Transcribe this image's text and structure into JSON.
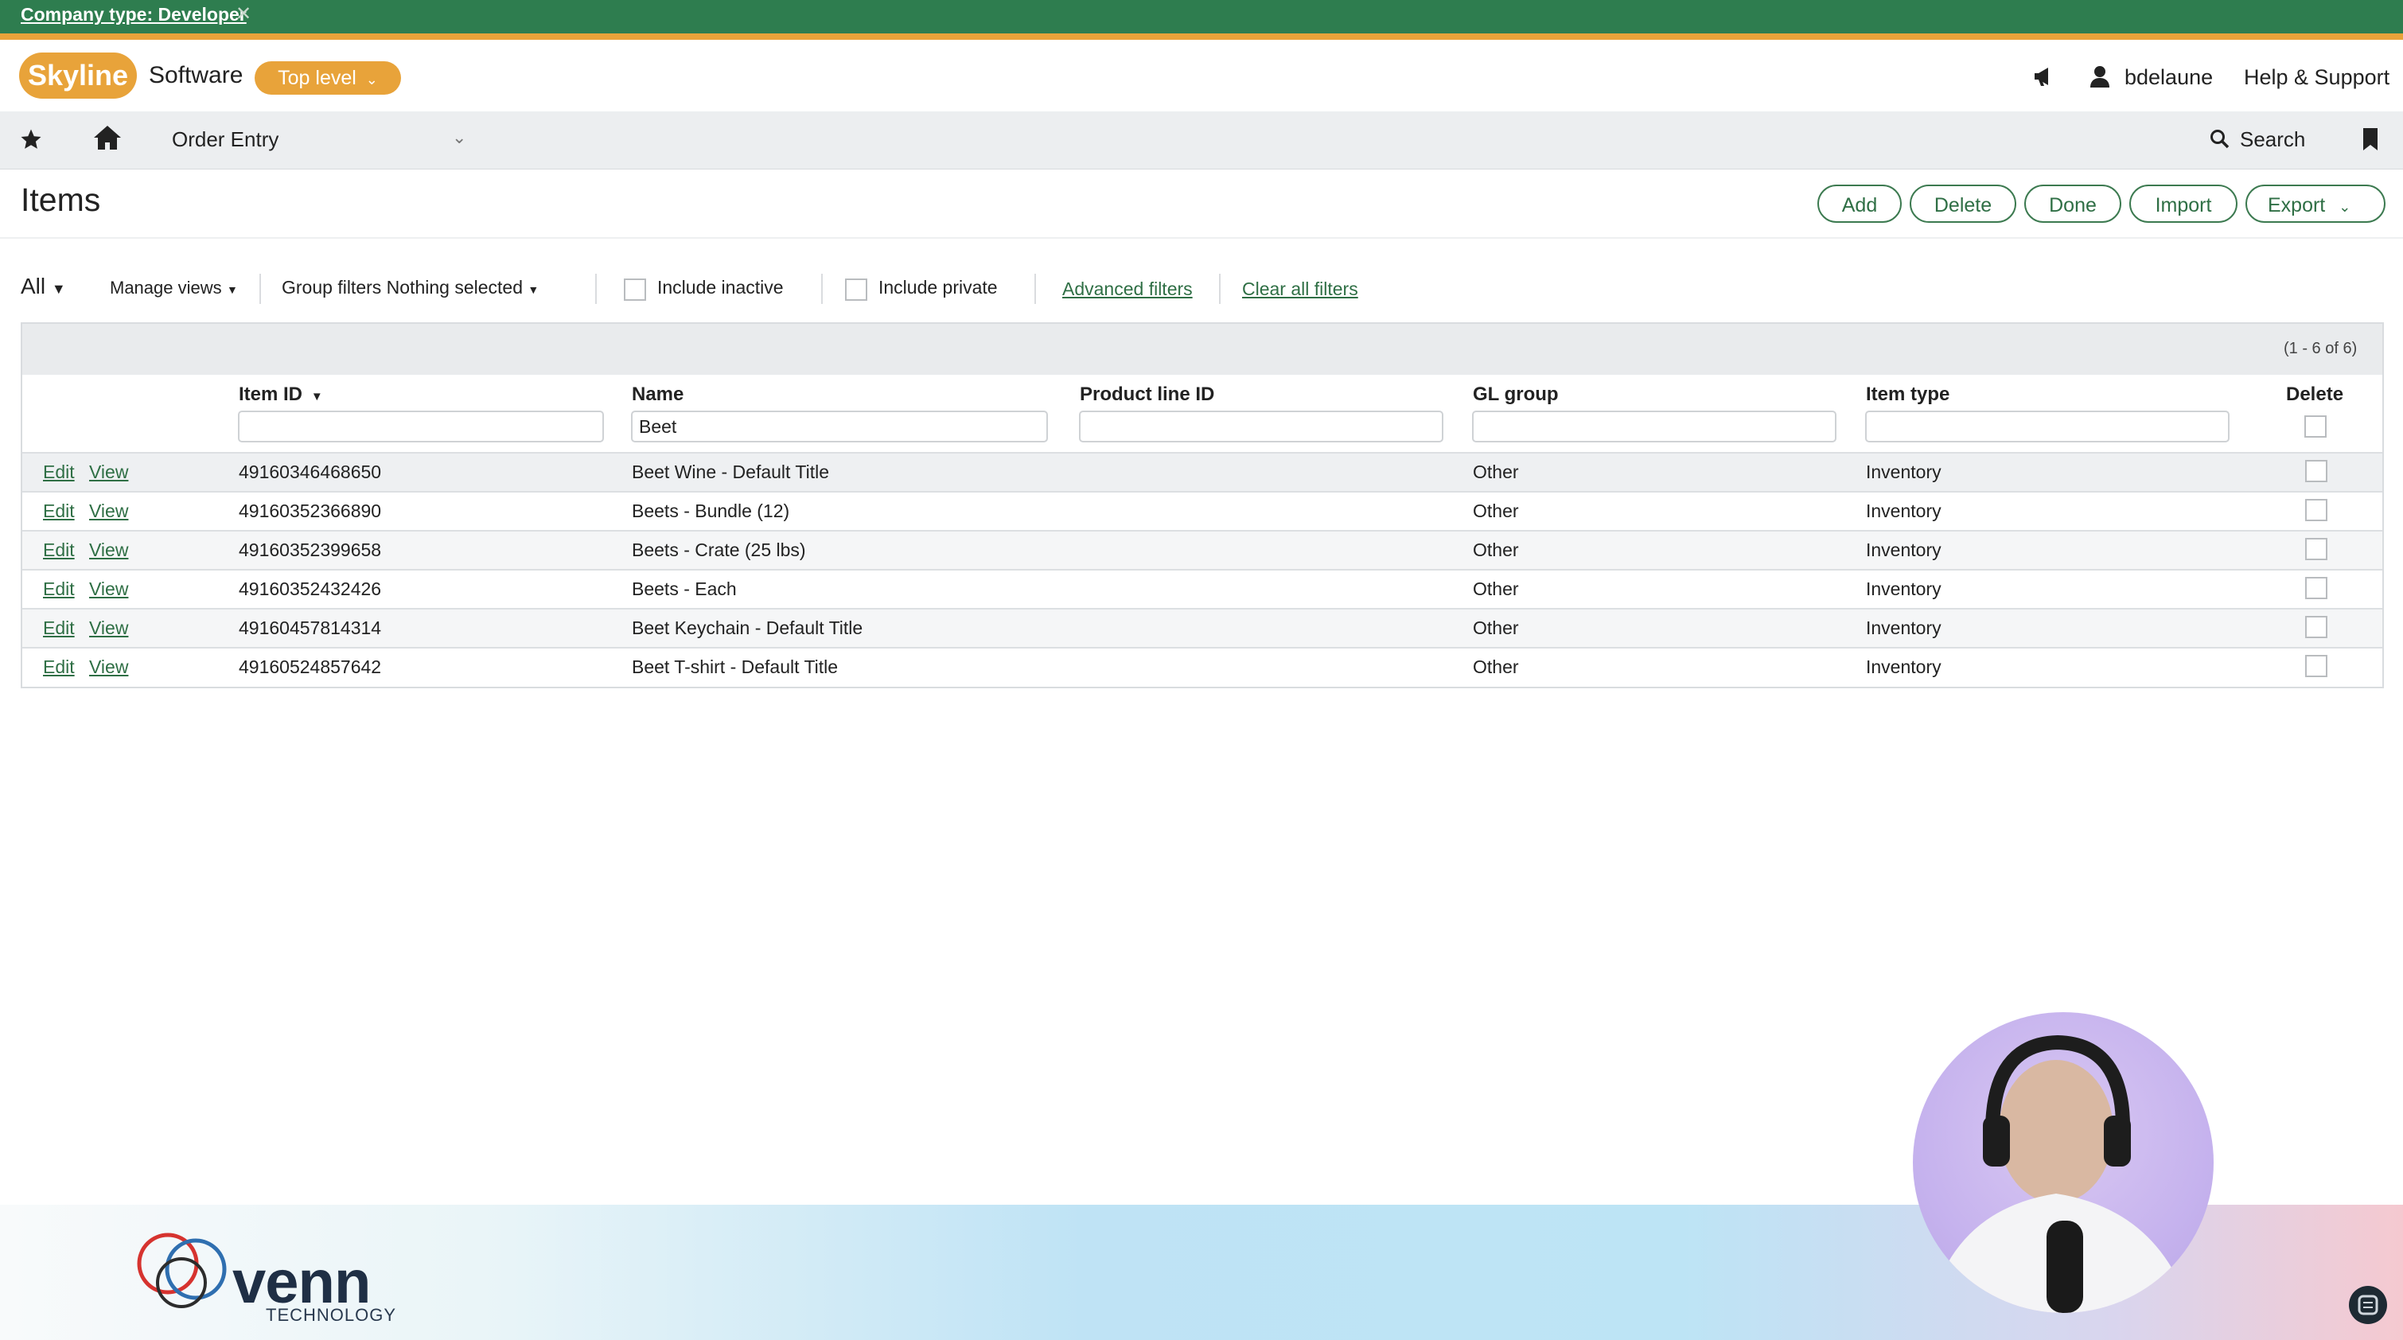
{
  "banner": {
    "text": "Company type: Developer",
    "close": "✕"
  },
  "header": {
    "logo": "Skyline",
    "logo_sub": "Software",
    "level": "Top level",
    "user": "bdelaune",
    "help": "Help & Support"
  },
  "nav": {
    "title": "Order Entry",
    "search": "Search"
  },
  "page": {
    "title": "Items",
    "buttons": {
      "add": "Add",
      "delete": "Delete",
      "done": "Done",
      "import": "Import",
      "export": "Export"
    }
  },
  "filters": {
    "view": "All",
    "manage_views": "Manage views",
    "group_filters_label": "Group filters",
    "group_filters_value": "Nothing selected",
    "include_inactive": "Include inactive",
    "include_private": "Include private",
    "advanced": "Advanced filters",
    "clear": "Clear all filters"
  },
  "grid": {
    "count": "(1 - 6 of 6)",
    "columns": {
      "item_id": "Item ID",
      "name": "Name",
      "product_line": "Product line ID",
      "gl_group": "GL group",
      "item_type": "Item type",
      "delete": "Delete"
    },
    "name_filter": "Beet",
    "edit_label": "Edit",
    "view_label": "View",
    "rows": [
      {
        "id": "49160346468650",
        "name": "Beet Wine - Default Title",
        "gl": "Other",
        "type": "Inventory"
      },
      {
        "id": "49160352366890",
        "name": "Beets - Bundle (12)",
        "gl": "Other",
        "type": "Inventory"
      },
      {
        "id": "49160352399658",
        "name": "Beets - Crate (25 lbs)",
        "gl": "Other",
        "type": "Inventory"
      },
      {
        "id": "49160352432426",
        "name": "Beets - Each",
        "gl": "Other",
        "type": "Inventory"
      },
      {
        "id": "49160457814314",
        "name": "Beet Keychain - Default Title",
        "gl": "Other",
        "type": "Inventory"
      },
      {
        "id": "49160524857642",
        "name": "Beet T-shirt - Default Title",
        "gl": "Other",
        "type": "Inventory"
      }
    ]
  },
  "footer": {
    "brand": "venn",
    "brand_sub": "TECHNOLOGY"
  },
  "colors": {
    "banner": "#2e7d4f",
    "accent": "#e8a33a",
    "link": "#2f6f45"
  },
  "icons": [
    "star-icon",
    "home-icon",
    "megaphone-icon",
    "user-icon",
    "search-icon",
    "bookmark-icon",
    "chevron-down-icon"
  ]
}
